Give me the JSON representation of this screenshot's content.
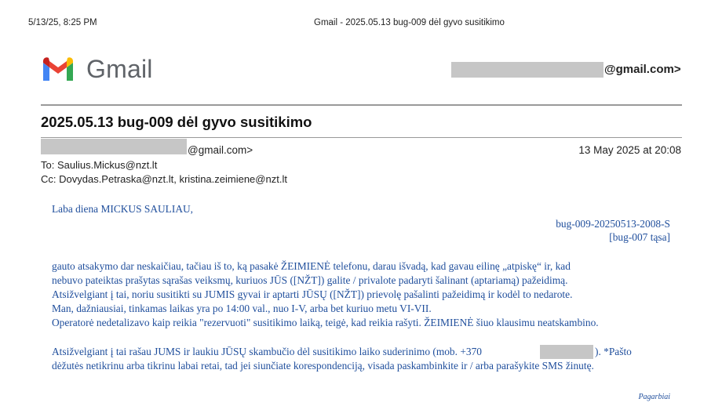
{
  "print_header": {
    "datetime": "5/13/25, 8:25 PM",
    "title": "Gmail - 2025.05.13 bug-009 dėl gyvo susitikimo"
  },
  "brand": {
    "name": "Gmail"
  },
  "account": {
    "domain_suffix": "@gmail.com>"
  },
  "message": {
    "subject": "2025.05.13 bug-009 dėl gyvo susitikimo",
    "from_domain": "@gmail.com>",
    "date": "13 May 2025 at 20:08",
    "to": "To: Saulius.Mickus@nzt.lt",
    "cc": "Cc: Dovydas.Petraska@nzt.lt, kristina.zeimiene@nzt.lt",
    "body": {
      "greeting": "Laba diena MICKUS SAULIAU,",
      "ref_line1": "bug-009-20250513-2008-S",
      "ref_line2": "[bug-007 tąsa]",
      "p1": [
        "gauto atsakymo dar neskaičiau, tačiau iš to, ką pasakė ŽEIMIENĖ telefonu, darau išvadą, kad gavau eilinę „atpiskę“ ir, kad",
        "nebuvo pateiktas prašytas sąrašas veiksmų, kuriuos JŪS ([NŽT]) galite / privalote padaryti šalinant (aptariamą) pažeidimą.",
        "Atsižvelgiant į tai, noriu susitikti su JUMIS gyvai ir aptarti JŪSŲ ([NŽT]) prievolę pašalinti pažeidimą ir kodėl to nedarote.",
        "Man, dažniausiai, tinkamas laikas yra po 14:00 val., nuo I-V, arba bet kuriuo metu VI-VII.",
        "Operatorė nedetalizavo kaip reikia \"rezervuoti\" susitikimo laiką, teigė, kad reikia rašyti. ŽEIMIENĖ šiuo klausimu neatskambino."
      ],
      "p2_line1_start": "Atsižvelgiant į tai rašau JUMS ir laukiu JŪSŲ skambučio dėl susitikimo laiko suderinimo (mob. +370",
      "p2_line1_end": "). *Pašto",
      "p2_line2": "dėžutės netikrinu arba tikrinu labai retai, tad jei siunčiate korespondenciją, visada paskambinkite ir / arba parašykite SMS žinutę.",
      "signoff": "Pagarbiai"
    }
  },
  "colors": {
    "body_text": "#1f4e9c",
    "redaction": "#c6c6c6"
  }
}
